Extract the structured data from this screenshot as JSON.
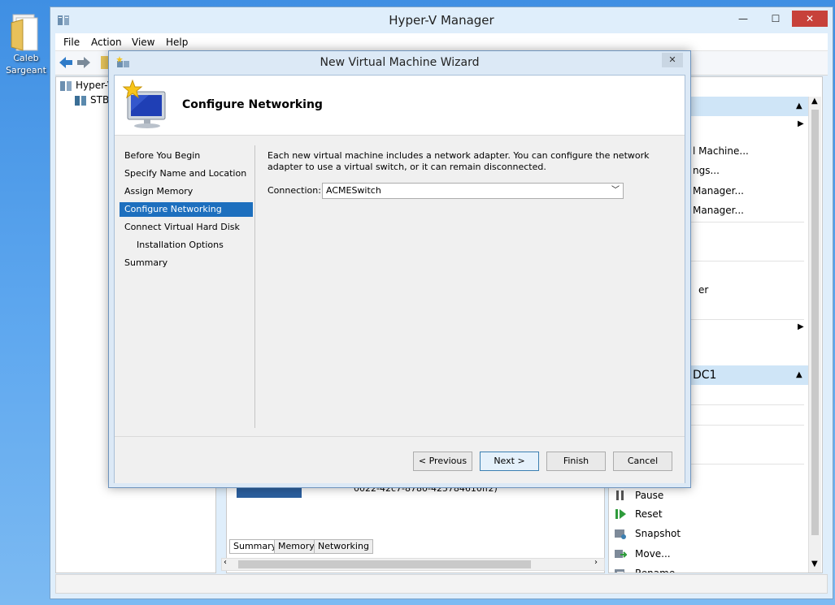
{
  "desktop": {
    "icon_label_line1": "Caleb",
    "icon_label_line2": "Sargeant"
  },
  "window": {
    "title": "Hyper-V Manager",
    "minimize": "—",
    "maximize": "☐",
    "close": "✕"
  },
  "menu": [
    "File",
    "Action",
    "View",
    "Help"
  ],
  "tree": {
    "root": "Hyper-V",
    "server": "STB"
  },
  "actions": {
    "items_top": [
      "l Machine...",
      "ngs...",
      "Manager...",
      "Manager..."
    ],
    "item_mid": "er",
    "vm_header": "DC1",
    "items_bottom": [
      "Pause",
      "Reset",
      "Snapshot",
      "Move...",
      "Rename..."
    ]
  },
  "center": {
    "partial_text": "0022-42c7-8780-425784610ff2)",
    "tabs": [
      "Summary",
      "Memory",
      "Networking"
    ]
  },
  "wizard": {
    "title": "New Virtual Machine Wizard",
    "close": "✕",
    "heading": "Configure Networking",
    "steps": [
      "Before You Begin",
      "Specify Name and Location",
      "Assign Memory",
      "Configure Networking",
      "Connect Virtual Hard Disk",
      "Installation Options",
      "Summary"
    ],
    "description": "Each new virtual machine includes a network adapter. You can configure the network adapter to use a virtual switch, or it can remain disconnected.",
    "connection_label": "Connection:",
    "connection_value": "ACMESwitch",
    "buttons": {
      "previous": "< Previous",
      "next": "Next >",
      "finish": "Finish",
      "cancel": "Cancel"
    }
  },
  "colors": {
    "accent": "#1d6fbe",
    "titlebar": "#dfeefb",
    "close_red": "#c7413a"
  }
}
